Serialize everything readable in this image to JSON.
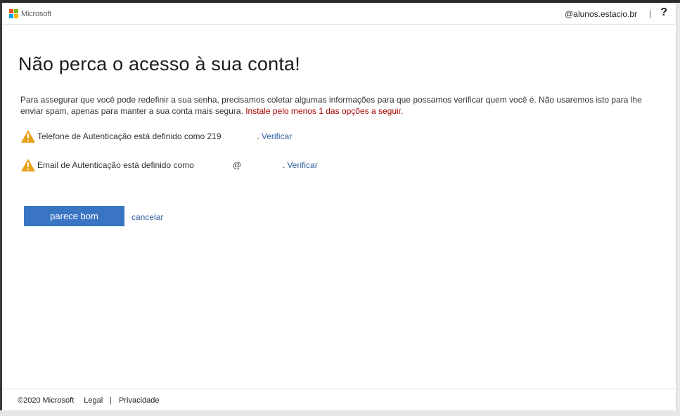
{
  "header": {
    "brand": "Microsoft",
    "account": "@alunos.estacio.br",
    "separator": "|",
    "help": "?",
    "logo_colors": [
      "#f25022",
      "#7fba00",
      "#00a4ef",
      "#ffb900"
    ]
  },
  "main": {
    "title": "Não perca o acesso à sua conta!",
    "intro": "Para assegurar que você pode redefinir a sua senha, precisamos coletar algumas informações para que possamos verificar quem você é. Não usaremos isto para lhe enviar spam, apenas para manter a sua conta mais segura.",
    "intro_highlight": "Instale pelo menos 1 das opções a seguir.",
    "phone": {
      "text": "Telefone de Autenticação está definido como 219",
      "suffix": ".",
      "link": "Verificar"
    },
    "email": {
      "text": "Email de Autenticação está definido como",
      "at": "@",
      "suffix": ".",
      "link": "Verificar"
    },
    "primary_button": "parece bom",
    "cancel_link": "cancelar"
  },
  "footer": {
    "copyright": "©2020 Microsoft",
    "legal": "Legal",
    "separator": "|",
    "privacy": "Privacidade"
  },
  "colors": {
    "accent": "#3a75c4",
    "link": "#2e5f9e",
    "warning": "#e8a016",
    "error": "#a80000"
  }
}
